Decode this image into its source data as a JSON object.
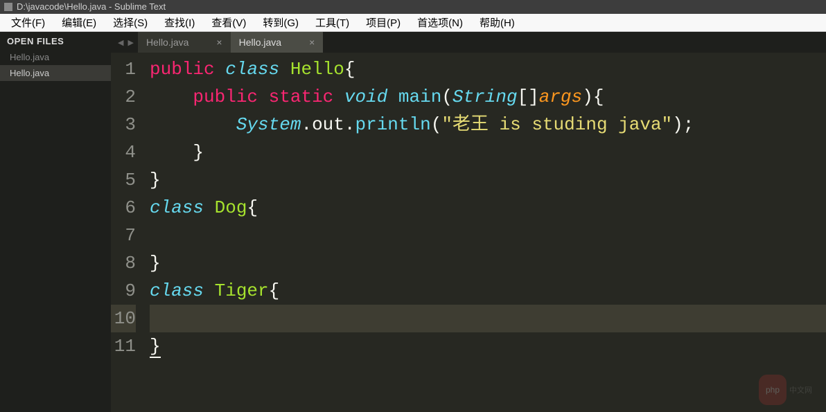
{
  "window": {
    "title": "D:\\javacode\\Hello.java - Sublime Text"
  },
  "menu": {
    "items": [
      "文件(F)",
      "编辑(E)",
      "选择(S)",
      "查找(I)",
      "查看(V)",
      "转到(G)",
      "工具(T)",
      "项目(P)",
      "首选项(N)",
      "帮助(H)"
    ]
  },
  "sidebar": {
    "header": "OPEN FILES",
    "files": [
      {
        "name": "Hello.java",
        "active": false
      },
      {
        "name": "Hello.java",
        "active": true
      }
    ]
  },
  "tabs": [
    {
      "name": "Hello.java",
      "active": false
    },
    {
      "name": "Hello.java",
      "active": true
    }
  ],
  "code": {
    "current_line": 10,
    "lines": [
      {
        "n": 1,
        "tokens": [
          {
            "t": "public",
            "c": "k-keyword"
          },
          {
            "t": " ",
            "c": ""
          },
          {
            "t": "class",
            "c": "k-storage"
          },
          {
            "t": " ",
            "c": ""
          },
          {
            "t": "Hello",
            "c": "k-class"
          },
          {
            "t": "{",
            "c": "k-punc"
          }
        ]
      },
      {
        "n": 2,
        "tokens": [
          {
            "t": "    ",
            "c": ""
          },
          {
            "t": "public",
            "c": "k-keyword"
          },
          {
            "t": " ",
            "c": ""
          },
          {
            "t": "static",
            "c": "k-keyword"
          },
          {
            "t": " ",
            "c": ""
          },
          {
            "t": "void",
            "c": "k-type"
          },
          {
            "t": " ",
            "c": ""
          },
          {
            "t": "main",
            "c": "k-func"
          },
          {
            "t": "(",
            "c": "k-punc"
          },
          {
            "t": "String",
            "c": "k-type"
          },
          {
            "t": "[]",
            "c": "k-punc"
          },
          {
            "t": "args",
            "c": "k-param"
          },
          {
            "t": "){",
            "c": "k-punc"
          }
        ]
      },
      {
        "n": 3,
        "tokens": [
          {
            "t": "        ",
            "c": ""
          },
          {
            "t": "System",
            "c": "k-type"
          },
          {
            "t": ".",
            "c": "k-punc"
          },
          {
            "t": "out",
            "c": "k-var"
          },
          {
            "t": ".",
            "c": "k-punc"
          },
          {
            "t": "println",
            "c": "k-func"
          },
          {
            "t": "(",
            "c": "k-punc"
          },
          {
            "t": "\"老王 is studing java\"",
            "c": "k-string"
          },
          {
            "t": ");",
            "c": "k-punc"
          }
        ]
      },
      {
        "n": 4,
        "tokens": [
          {
            "t": "    }",
            "c": "k-punc"
          }
        ]
      },
      {
        "n": 5,
        "tokens": [
          {
            "t": "}",
            "c": "k-punc"
          }
        ]
      },
      {
        "n": 6,
        "tokens": [
          {
            "t": "class",
            "c": "k-storage"
          },
          {
            "t": " ",
            "c": ""
          },
          {
            "t": "Dog",
            "c": "k-class"
          },
          {
            "t": "{",
            "c": "k-punc"
          }
        ]
      },
      {
        "n": 7,
        "tokens": []
      },
      {
        "n": 8,
        "tokens": [
          {
            "t": "}",
            "c": "k-punc"
          }
        ]
      },
      {
        "n": 9,
        "tokens": [
          {
            "t": "class",
            "c": "k-storage"
          },
          {
            "t": " ",
            "c": ""
          },
          {
            "t": "Tiger",
            "c": "k-class"
          },
          {
            "t": "{",
            "c": "k-punc"
          }
        ]
      },
      {
        "n": 10,
        "tokens": []
      },
      {
        "n": 11,
        "tokens": [
          {
            "t": "}",
            "c": "k-punc",
            "cursor": true
          }
        ]
      }
    ]
  },
  "watermark": {
    "badge": "php",
    "text": "中文网"
  }
}
